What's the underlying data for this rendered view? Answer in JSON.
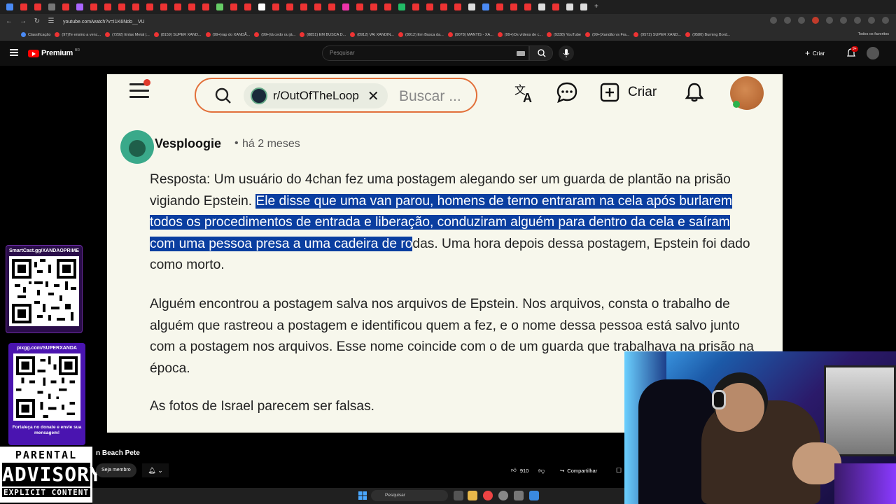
{
  "browser": {
    "url": "youtube.com/watch?v=I1K6Ndo__VU",
    "bookmarks": [
      "Classificação",
      "(97)Te ensino a venc...",
      "(7292) Enlax Metal |...",
      "(8159) SUPER XAND...",
      "(99+)rap do XANDÃ...",
      "(99+)tá cedo ou já...",
      "(8851) EM BUSCA D...",
      "(8912) VAI XANDIN...",
      "(8912) Em Busca da...",
      "(9078) MANTIS - XA...",
      "(99+)Os vídeos de c...",
      "(9338) YouTube",
      "(99+)Xandão vs Fra...",
      "(9572) SUPER XAND...",
      "(9580) Burning Bord..."
    ],
    "bookmarks_right": "Todos os favoritos"
  },
  "youtube": {
    "logo_text": "Premium",
    "region": "BR",
    "search_placeholder": "Pesquisar",
    "create_label": "Criar",
    "notif_count": "9+",
    "channel_name": "n Beach Pete",
    "join_label": "Seja membro",
    "like_count": "910",
    "share_label": "Compartilhar"
  },
  "video": {
    "subreddit": "r/OutOfTheLoop",
    "search_placeholder": "Buscar ...",
    "create_label": "Criar",
    "username": "Vesploogie",
    "timestamp": "há 2 meses",
    "p1_a": "Resposta: Um usuário do 4chan fez uma postagem alegando ser um guarda de plantão na prisão vigiando Epstein. ",
    "p1_hl": "Ele disse que uma van parou, homens de terno entraram na cela após burlarem todos os procedimentos de entrada e liberação, conduziram alguém para dentro da cela e saíram com uma pessoa presa a uma cadeira de ro",
    "p1_b": "das. Uma hora depois dessa postagem, Epstein foi dado como morto.",
    "p2": "Alguém encontrou a postagem salva nos arquivos de Epstein. Nos arquivos, consta o trabalho de alguém que rastreou a postagem e identificou quem a fez, e o nome dessa pessoa está salvo junto com a postagem nos arquivos. Esse nome coincide com o de um guarda que trabalhava na prisão na época.",
    "p3": "As fotos de Israel parecem ser falsas."
  },
  "overlays": {
    "qr1_label": "SmartCast.gg/XANDAOPRIME",
    "qr2_label": "pixgg.com/SUPERXANDA",
    "qr2_footer": "Fortaleça no donate e envie sua mensagem!",
    "advisory_top": "PARENTAL",
    "advisory_mid": "ADVISORY",
    "advisory_bot": "EXPLICIT CONTENT"
  },
  "taskbar": {
    "search_label": "Pesquisar"
  },
  "colors": {
    "highlight": "#0a3ea0",
    "reddit_orange": "#e2703a",
    "yt_red": "#ff0000"
  }
}
